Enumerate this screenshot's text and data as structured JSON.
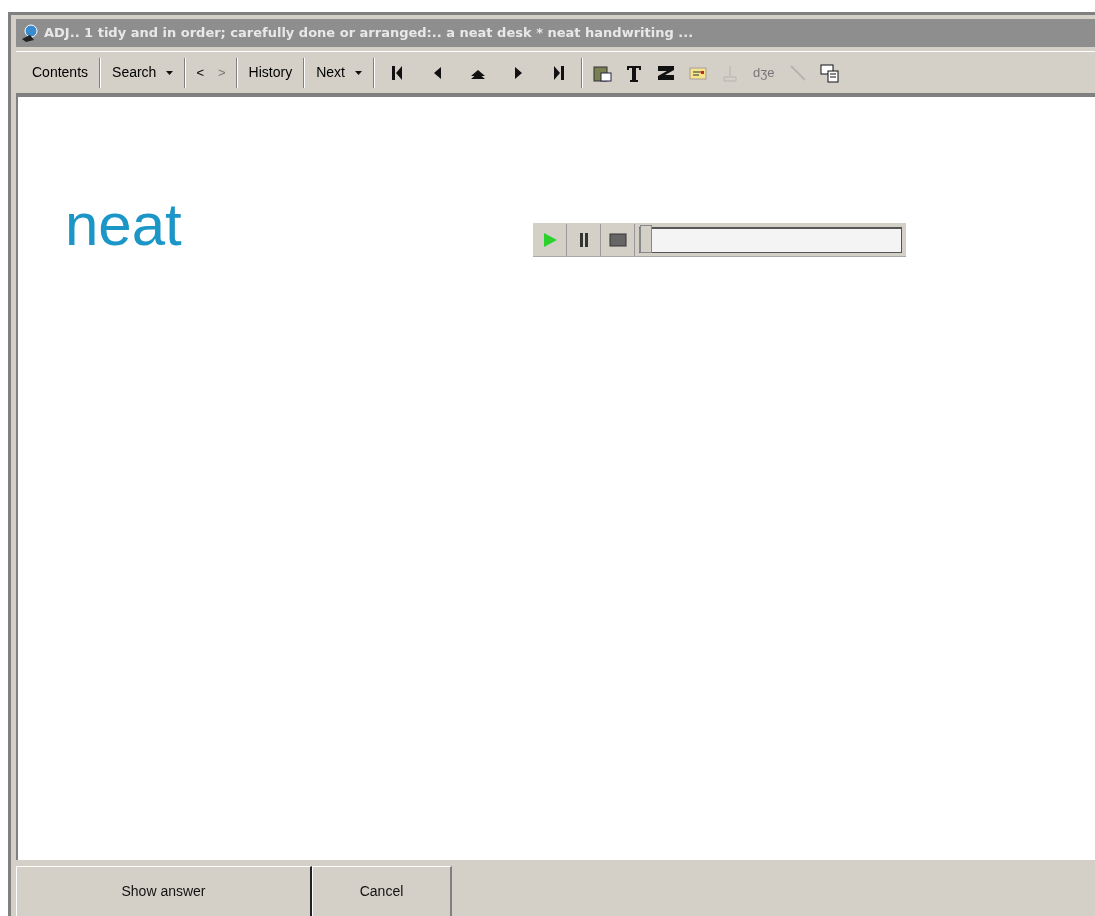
{
  "window": {
    "title": "ADJ.. 1  tidy and in order; carefully done or arranged:.. a neat desk * neat handwriting ..."
  },
  "toolbar": {
    "items": [
      {
        "kind": "button",
        "label": "Contents"
      },
      {
        "kind": "separator"
      },
      {
        "kind": "dropdown",
        "label": "Search"
      },
      {
        "kind": "separator"
      },
      {
        "kind": "small",
        "label": "<",
        "disabled": false
      },
      {
        "kind": "small",
        "label": ">",
        "disabled": true
      },
      {
        "kind": "separator"
      },
      {
        "kind": "button",
        "label": "History"
      },
      {
        "kind": "separator"
      },
      {
        "kind": "dropdown",
        "label": "Next"
      },
      {
        "kind": "separator"
      },
      {
        "kind": "icon",
        "disabled": false
      },
      {
        "kind": "icon",
        "disabled": false
      },
      {
        "kind": "icon",
        "disabled": false
      },
      {
        "kind": "icon",
        "disabled": false
      },
      {
        "kind": "icon",
        "disabled": false
      },
      {
        "kind": "separator"
      },
      {
        "kind": "icon",
        "disabled": false
      },
      {
        "kind": "icon",
        "disabled": false
      },
      {
        "kind": "icon",
        "disabled": false
      },
      {
        "kind": "icon",
        "disabled": false
      },
      {
        "kind": "icon",
        "disabled": true
      },
      {
        "kind": "small",
        "label": "dʒe",
        "disabled": true
      },
      {
        "kind": "icon",
        "disabled": true
      },
      {
        "kind": "icon",
        "disabled": false
      }
    ]
  },
  "card": {
    "word": "neat",
    "player": {
      "level": 0
    }
  },
  "buttons": [
    {
      "label": "Show answer",
      "default": true
    },
    {
      "label": "Cancel",
      "default": false
    }
  ]
}
